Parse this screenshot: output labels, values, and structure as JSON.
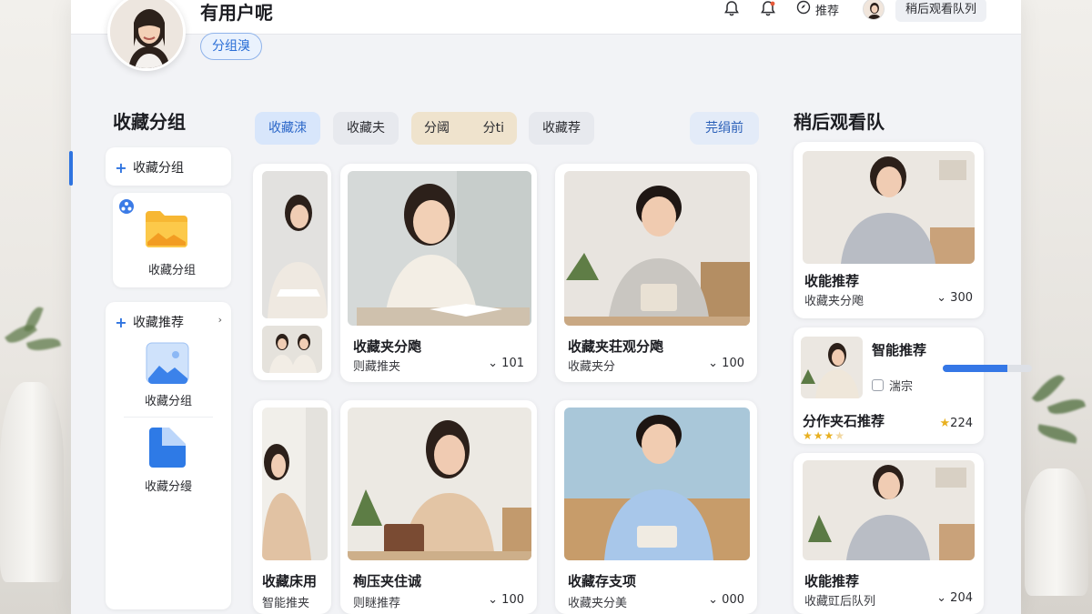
{
  "header": {
    "username": "有用户呢",
    "group_pill": "分组溴",
    "recommend_label": "推荐",
    "queue_button": "稍后观看队列"
  },
  "sidebar": {
    "title": "收藏分组",
    "items": [
      {
        "label": "收藏分组",
        "active": true
      },
      {
        "label": "收藏分组",
        "icon": "folder-icon"
      },
      {
        "label": "收藏推荐"
      },
      {
        "label": "收藏分组",
        "icon": "image-folder-icon"
      },
      {
        "label": "收藏分缦",
        "icon": "blue-folder-icon"
      }
    ]
  },
  "tabs": [
    {
      "label": "收藏洓",
      "active": true
    },
    {
      "label": "收藏夫"
    },
    {
      "label": "分阈"
    },
    {
      "label": "分ti"
    },
    {
      "label": "收藏荐"
    },
    {
      "label": "芫绢前"
    }
  ],
  "grid": [
    {
      "title": "收藏夹分飑",
      "sub": "则藏推夹",
      "count": "101"
    },
    {
      "title": "收藏夹荘观分飑",
      "sub": "收藏夹分",
      "count": "100"
    },
    {
      "title": "收藏床用",
      "sub": "智能推夹",
      "count": ""
    },
    {
      "title": "栒压夹住诚",
      "sub": "则瞇推荐",
      "count": "100"
    },
    {
      "title": "收藏存支项",
      "sub": "收藏夹分美",
      "count": "000"
    }
  ],
  "right_panel": {
    "title": "稍后观看队",
    "cards": [
      {
        "title": "收能推荐",
        "sub": "收藏夹分飑",
        "count": "300"
      },
      {
        "title": "智能推荐",
        "check_label": "湍宗",
        "progress": 0.72,
        "subtitle": "分作夹石推荐",
        "rating": 3,
        "rating_max": 4,
        "count": "224"
      },
      {
        "title": "收能推荐",
        "sub": "收藏豇后队列",
        "count": "204"
      }
    ]
  },
  "colors": {
    "accent": "#2f74e0",
    "star": "#e8b020"
  }
}
